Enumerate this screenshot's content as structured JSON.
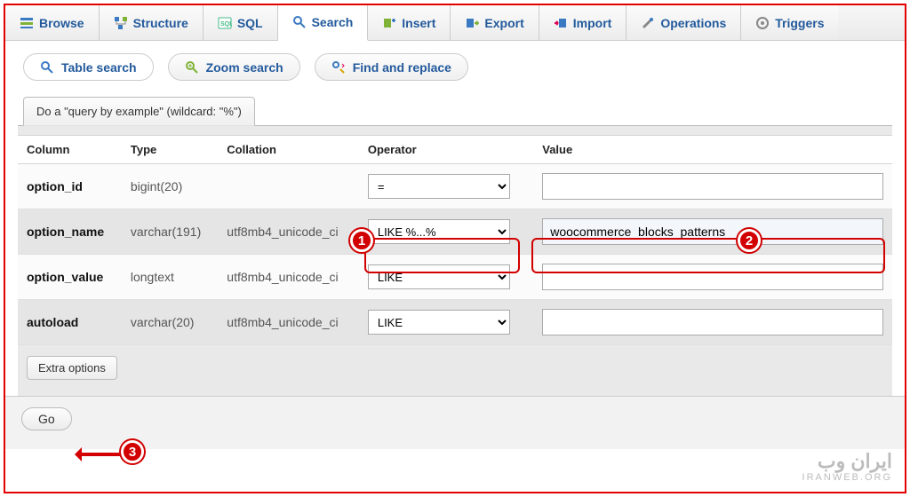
{
  "toptabs": {
    "browse": "Browse",
    "structure": "Structure",
    "sql": "SQL",
    "search": "Search",
    "insert": "Insert",
    "export": "Export",
    "import": "Import",
    "operations": "Operations",
    "triggers": "Triggers"
  },
  "subtabs": {
    "table_search": "Table search",
    "zoom_search": "Zoom search",
    "find_replace": "Find and replace"
  },
  "panel": {
    "title": "Do a \"query by example\" (wildcard: \"%\")"
  },
  "headers": {
    "column": "Column",
    "type": "Type",
    "collation": "Collation",
    "operator": "Operator",
    "value": "Value"
  },
  "rows": [
    {
      "col": "option_id",
      "type": "bigint(20)",
      "collation": "",
      "op": "=",
      "val": ""
    },
    {
      "col": "option_name",
      "type": "varchar(191)",
      "collation": "utf8mb4_unicode_ci",
      "op": "LIKE %...%",
      "val": "woocommerce_blocks_patterns"
    },
    {
      "col": "option_value",
      "type": "longtext",
      "collation": "utf8mb4_unicode_ci",
      "op": "LIKE",
      "val": ""
    },
    {
      "col": "autoload",
      "type": "varchar(20)",
      "collation": "utf8mb4_unicode_ci",
      "op": "LIKE",
      "val": ""
    }
  ],
  "buttons": {
    "extra": "Extra options",
    "go": "Go"
  },
  "annotations": {
    "m1": "1",
    "m2": "2",
    "m3": "3"
  },
  "watermark": {
    "fa": "ایران وب",
    "en": "IRANWEB.ORG"
  }
}
